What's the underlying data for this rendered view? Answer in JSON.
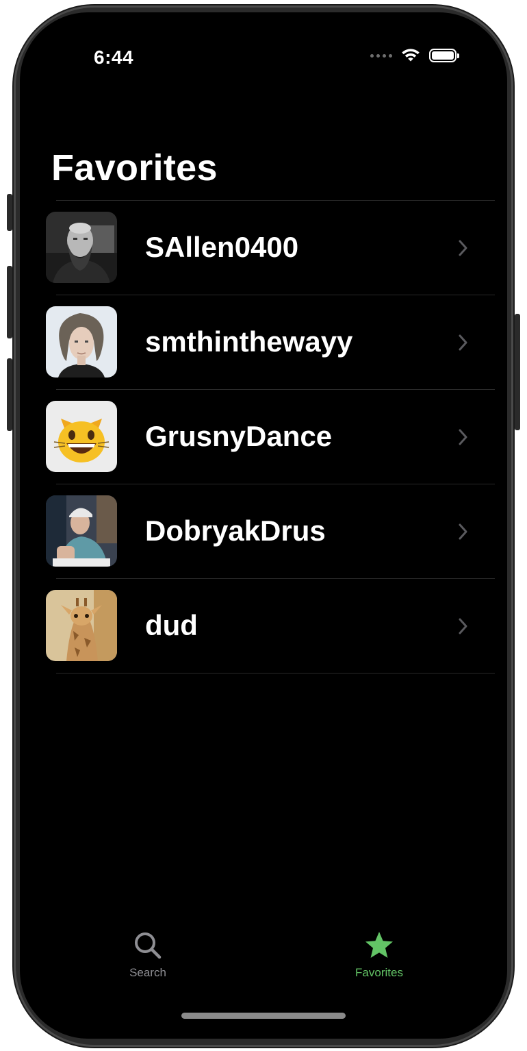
{
  "status_bar": {
    "time": "6:44",
    "wifi_icon": "wifi-icon",
    "battery_icon": "battery-full-icon"
  },
  "header": {
    "title": "Favorites"
  },
  "favorites": [
    {
      "username": "SAllen0400",
      "avatar": "bearded-man-photo"
    },
    {
      "username": "smthinthewayy",
      "avatar": "long-haired-person-portrait"
    },
    {
      "username": "GrusnyDance",
      "avatar": "grinning-cat-emoji"
    },
    {
      "username": "DobryakDrus",
      "avatar": "man-in-cap-photo"
    },
    {
      "username": "dud",
      "avatar": "baby-giraffe-photo"
    }
  ],
  "tabbar": {
    "tabs": [
      {
        "label": "Search",
        "icon": "magnifier-icon",
        "selected": false
      },
      {
        "label": "Favorites",
        "icon": "star-icon",
        "selected": true
      }
    ]
  },
  "colors": {
    "background": "#000000",
    "accent": "#63c466",
    "inactive_tab": "#8e8e93",
    "chevron": "#5a5a5e",
    "divider": "#2a2a2a"
  }
}
